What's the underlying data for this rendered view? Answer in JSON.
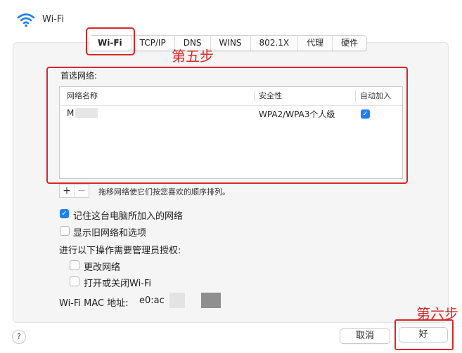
{
  "window": {
    "title": "Wi-Fi",
    "icon": "wifi-icon",
    "accent": "#1f7ff5"
  },
  "tabs": [
    {
      "label": "Wi-Fi",
      "selected": true
    },
    {
      "label": "TCP/IP"
    },
    {
      "label": "DNS"
    },
    {
      "label": "WINS"
    },
    {
      "label": "802.1X"
    },
    {
      "label": "代理"
    },
    {
      "label": "硬件"
    }
  ],
  "annotations": {
    "step5": "第五步",
    "step6": "第六步",
    "color": "#d9262a"
  },
  "preferred_networks": {
    "label": "首选网络:",
    "columns": {
      "name": "网络名称",
      "security": "安全性",
      "auto_join": "自动加入"
    },
    "rows": [
      {
        "name": "M",
        "security": "WPA2/WPA3个人级",
        "auto_join": true
      }
    ]
  },
  "list_controls": {
    "add": "+",
    "remove": "−",
    "hint": "拖移网络使它们按您喜欢的顺序排列。"
  },
  "options": {
    "remember": {
      "label": "记住这台电脑所加入的网络",
      "checked": true
    },
    "show_legacy": {
      "label": "显示旧网络和选项",
      "checked": false
    }
  },
  "admin": {
    "label": "进行以下操作需要管理员授权:",
    "change_networks": {
      "label": "更改网络",
      "checked": false
    },
    "toggle_wifi": {
      "label": "打开或关闭Wi-Fi",
      "checked": false
    }
  },
  "mac": {
    "label": "Wi-Fi MAC 地址:",
    "value": "e0:ac"
  },
  "buttons": {
    "help": "?",
    "cancel": "取消",
    "ok": "好"
  }
}
